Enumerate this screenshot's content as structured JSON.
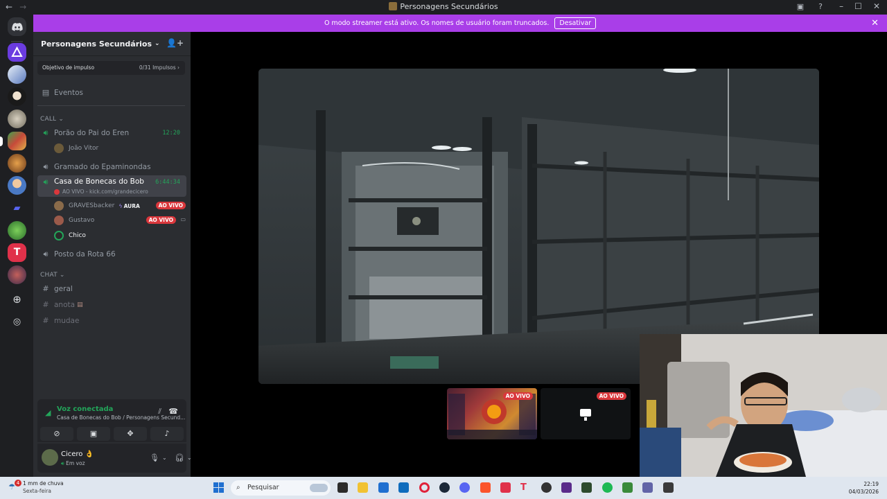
{
  "window": {
    "title": "Personagens Secundários",
    "nav_back": "←",
    "nav_forward": "→",
    "min": "–",
    "max": "☐",
    "close": "✕"
  },
  "banner": {
    "text": "O modo streamer está ativo. Os nomes de usuário foram truncados.",
    "button": "Desativar",
    "close": "✕"
  },
  "guild": {
    "name": "Personagens Secundários",
    "chevron": "⌄",
    "boost_label": "Objetivo de impulso",
    "boost_value": "0/31 Impulsos",
    "boost_arrow": "›",
    "events": "Eventos"
  },
  "categories": {
    "call": "CALL",
    "chat": "CHAT",
    "chevron": "⌄"
  },
  "voice_channels": [
    {
      "name": "Porão do Pai do Eren",
      "time": "12:20"
    },
    {
      "name": "Gramado do Epaminondas"
    },
    {
      "name": "Casa de Bonecas do Bob",
      "time": "6:44:34",
      "sub": "AO VIVO - kick.com/grandecicero"
    },
    {
      "name": "Posto da Rota 66"
    }
  ],
  "voice_users": {
    "porao": [
      {
        "name": "João Vitor"
      }
    ],
    "casa": [
      {
        "name": "GRAVESbacker",
        "tag": "AURA",
        "live": "AO VIVO"
      },
      {
        "name": "Gustavo",
        "live": "AO VIVO"
      },
      {
        "name": "Chico"
      }
    ]
  },
  "text_channels": [
    {
      "name": "geral"
    },
    {
      "name": "anota"
    },
    {
      "name": "mudae"
    }
  ],
  "voice_panel": {
    "status": "Voz conectada",
    "location": "Casa de Bonecas do Bob / Personagens Secund..."
  },
  "user_panel": {
    "name": "Cicero",
    "emoji": "👌",
    "status": "Em voz"
  },
  "streams": {
    "live_label": "AO VIVO"
  },
  "taskbar": {
    "weather": "1 mm de chuva",
    "weather_day": "Sexta-feira",
    "weather_badge": "4",
    "search_placeholder": "Pesquisar",
    "time": "22:19",
    "date": "04/03/2026"
  },
  "colors": {
    "brand": "#5865f2",
    "voice_green": "#23a55a",
    "live_red": "#da373c",
    "streamer_banner": "#a93ee8"
  }
}
